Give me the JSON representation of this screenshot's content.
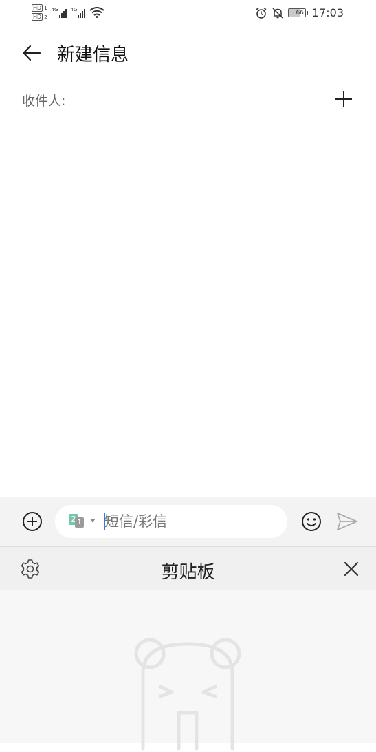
{
  "status_bar": {
    "time": "17:03",
    "battery": "66",
    "network_type_1": "4G",
    "network_type_2": "4G",
    "hd_label_1": "HD",
    "hd_label_2": "HD"
  },
  "header": {
    "title": "新建信息"
  },
  "recipient": {
    "label": "收件人:"
  },
  "compose": {
    "placeholder": "短信/彩信",
    "value": "",
    "sim_primary": "2",
    "sim_secondary": "1"
  },
  "clipboard": {
    "title": "剪贴板"
  },
  "colors": {
    "sim_green": "#72c8a8",
    "cursor_blue": "#2f7dd6"
  },
  "icons": [
    "back-arrow-icon",
    "add-contact-icon",
    "add-attachment-icon",
    "sim-card-icon",
    "emoji-icon",
    "send-icon",
    "settings-gear-icon",
    "close-icon",
    "bear-placeholder-icon",
    "alarm-icon",
    "mute-bell-icon",
    "wifi-icon",
    "signal-icon",
    "battery-icon"
  ]
}
